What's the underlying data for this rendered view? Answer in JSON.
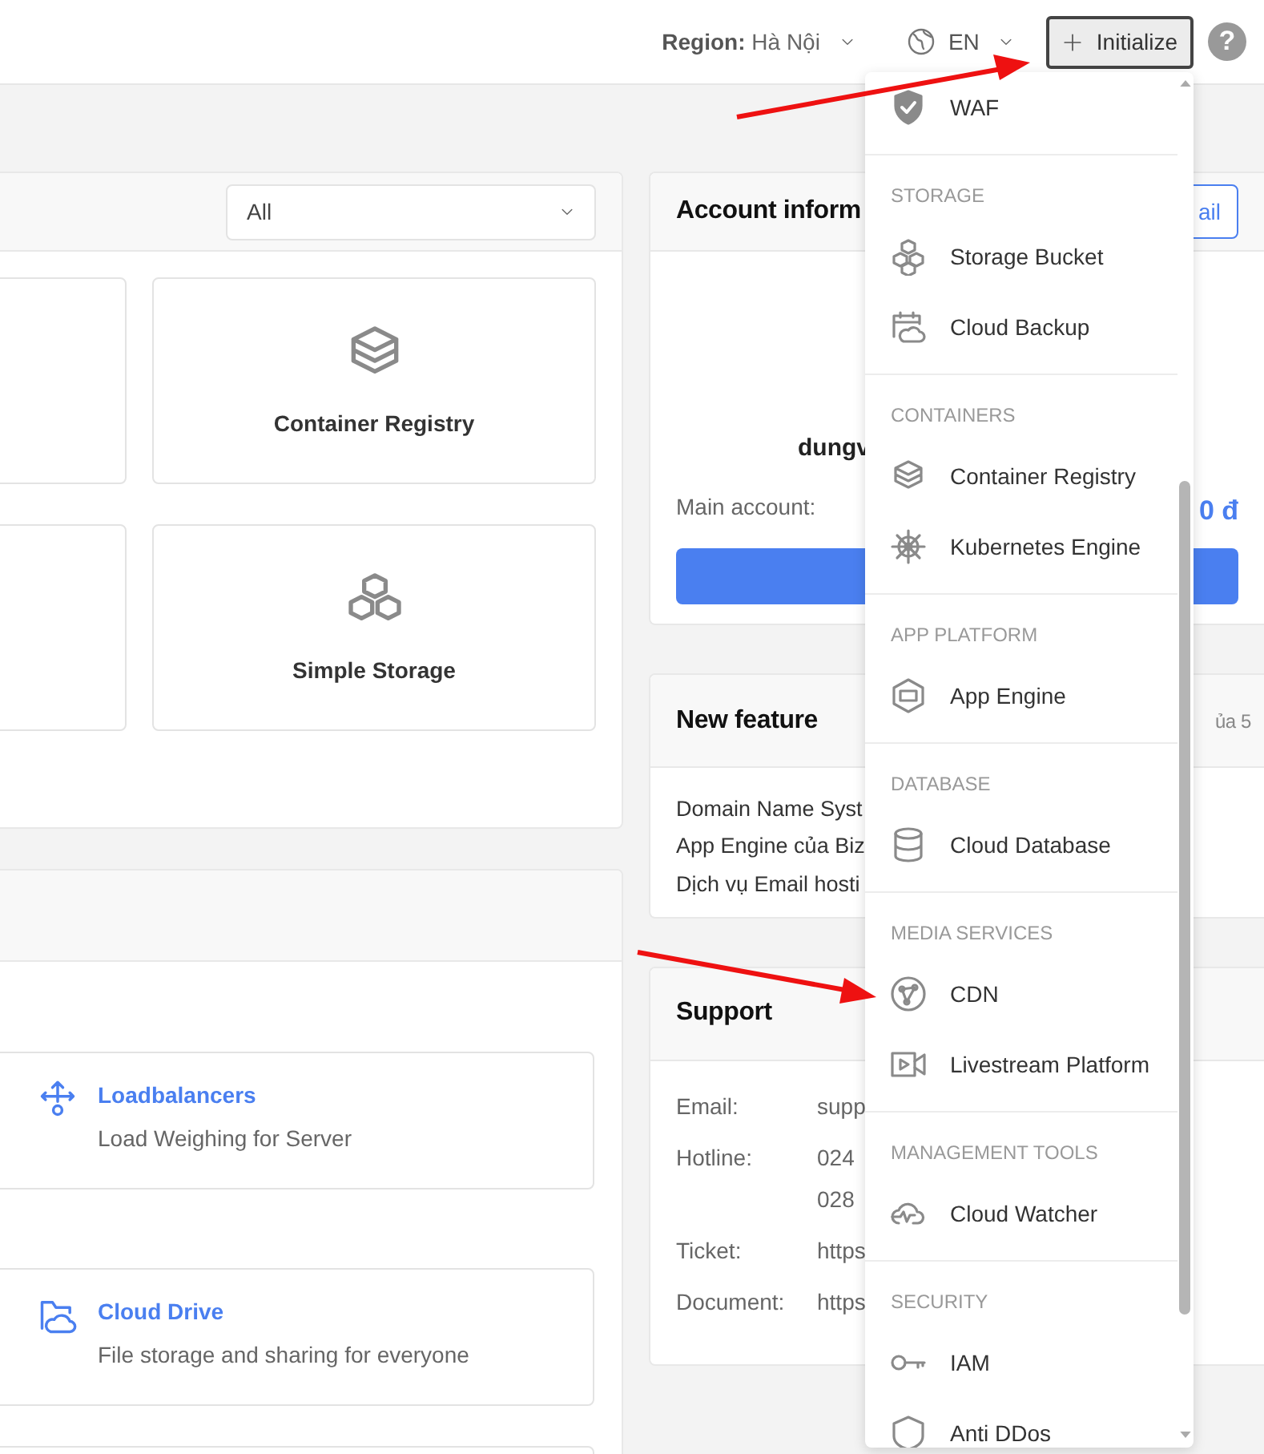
{
  "topbar": {
    "region_label": "Region:",
    "region_value": "Hà Nội",
    "language": "EN",
    "initialize_button": "Initialize",
    "help": "?"
  },
  "services_panel": {
    "filter": "All",
    "cards": [
      {
        "kind": "registry",
        "label": "Container Registry"
      },
      {
        "kind": "storage",
        "label": "Simple Storage"
      }
    ]
  },
  "featured_panel": {
    "items": [
      {
        "kind": "loadbalancer",
        "title": "Loadbalancers",
        "description": "Load Weighing for Server"
      },
      {
        "kind": "drive",
        "title": "Cloud Drive",
        "description": "File storage and sharing for everyone"
      }
    ]
  },
  "account": {
    "title": "Account inform",
    "button": "ail",
    "username": "dungv",
    "main_account_label": "Main account:",
    "main_account_value": "0 đ"
  },
  "new_feature": {
    "title": "New feature",
    "header_note": "ủa 5",
    "links": [
      "Domain Name Syst",
      "App Engine của Biz",
      "Dịch vụ Email hosti"
    ]
  },
  "support": {
    "title": "Support",
    "rows": [
      {
        "label": "Email:",
        "values": [
          "supp"
        ]
      },
      {
        "label": "Hotline:",
        "values": [
          "024",
          "028"
        ]
      },
      {
        "label": "Ticket:",
        "values": [
          "https"
        ]
      },
      {
        "label": "Document:",
        "values": [
          "https"
        ]
      }
    ]
  },
  "dropdown": {
    "sections": [
      {
        "items": [
          {
            "kind": "waf",
            "label": "WAF"
          }
        ]
      },
      {
        "heading": "STORAGE",
        "items": [
          {
            "kind": "bucket",
            "label": "Storage Bucket"
          },
          {
            "kind": "backup",
            "label": "Cloud Backup"
          }
        ]
      },
      {
        "heading": "CONTAINERS",
        "items": [
          {
            "kind": "registry",
            "label": "Container Registry"
          },
          {
            "kind": "kubernetes",
            "label": "Kubernetes Engine"
          }
        ]
      },
      {
        "heading": "APP PLATFORM",
        "items": [
          {
            "kind": "app",
            "label": "App Engine"
          }
        ]
      },
      {
        "heading": "DATABASE",
        "items": [
          {
            "kind": "database",
            "label": "Cloud Database"
          }
        ]
      },
      {
        "heading": "MEDIA SERVICES",
        "items": [
          {
            "kind": "cdn",
            "label": "CDN"
          },
          {
            "kind": "livestream",
            "label": "Livestream Platform"
          }
        ]
      },
      {
        "heading": "MANAGEMENT TOOLS",
        "items": [
          {
            "kind": "watcher",
            "label": "Cloud Watcher"
          }
        ]
      },
      {
        "heading": "SECURITY",
        "items": [
          {
            "kind": "iam",
            "label": "IAM"
          },
          {
            "kind": "ddos",
            "label": "Anti DDos"
          }
        ]
      }
    ]
  }
}
